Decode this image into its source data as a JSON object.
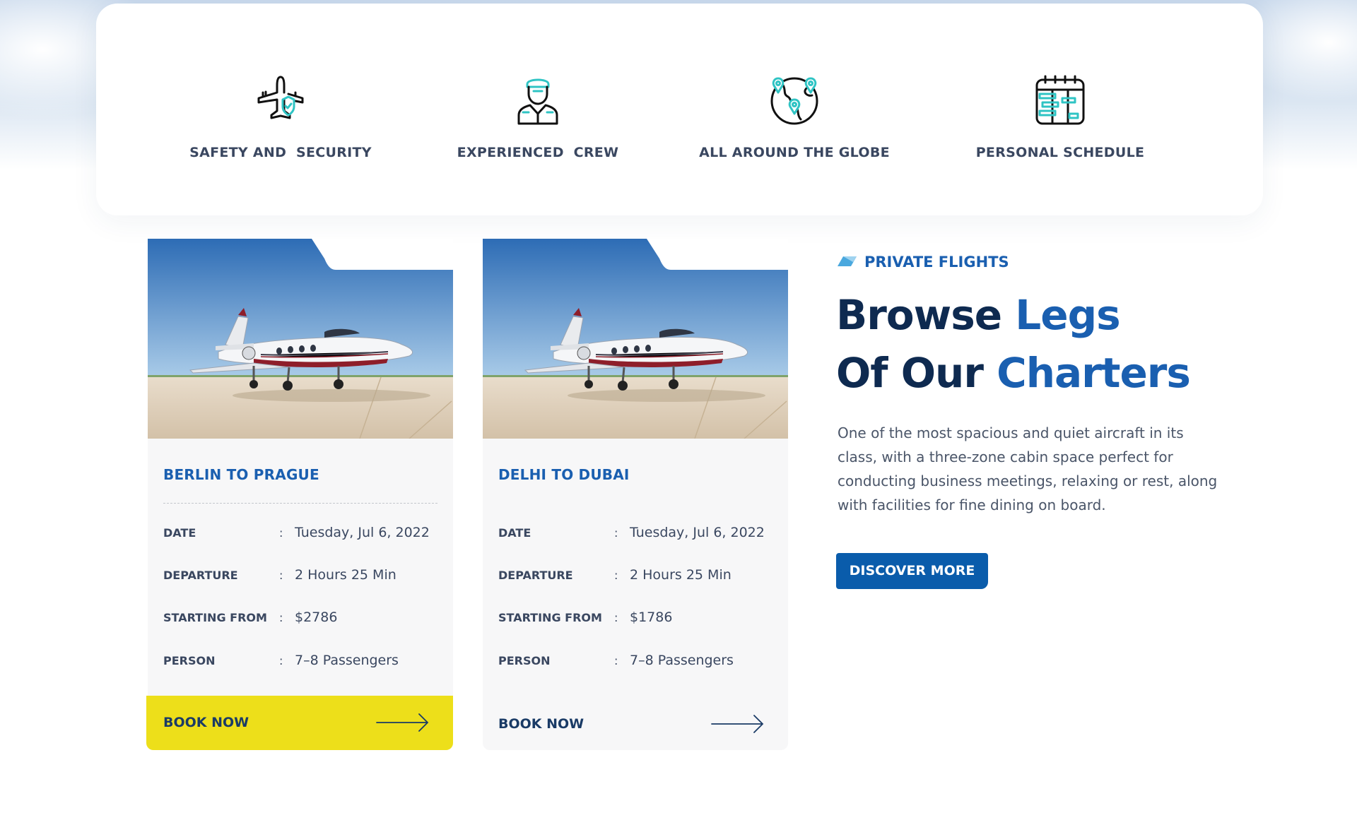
{
  "features": [
    {
      "label": "SAFETY AND  SECURITY",
      "icon": "airplane-shield-icon"
    },
    {
      "label": "EXPERIENCED  CREW",
      "icon": "pilot-icon"
    },
    {
      "label": "ALL AROUND THE GLOBE",
      "icon": "globe-pins-icon"
    },
    {
      "label": "PERSONAL SCHEDULE",
      "icon": "calendar-schedule-icon"
    }
  ],
  "cards": [
    {
      "route": "BERLIN TO PRAGUE",
      "rows": [
        {
          "key": "DATE",
          "sep": ":",
          "value": "Tuesday, Jul 6, 2022"
        },
        {
          "key": "DEPARTURE",
          "sep": ":",
          "value": "2 Hours 25 Min"
        },
        {
          "key": "STARTING FROM",
          "sep": ":",
          "value": "$2786"
        },
        {
          "key": "PERSON",
          "sep": ":",
          "value": "7–8 Passengers"
        }
      ],
      "book_label": "BOOK NOW",
      "book_active": true
    },
    {
      "route": "DELHI TO DUBAI",
      "rows": [
        {
          "key": "DATE",
          "sep": ":",
          "value": "Tuesday, Jul 6, 2022"
        },
        {
          "key": "DEPARTURE",
          "sep": ":",
          "value": "2 Hours 25 Min"
        },
        {
          "key": "STARTING FROM",
          "sep": ":",
          "value": "$1786"
        },
        {
          "key": "PERSON",
          "sep": ":",
          "value": "7–8 Passengers"
        }
      ],
      "book_label": "BOOK NOW",
      "book_active": false
    }
  ],
  "section": {
    "tagline": "PRIVATE FLIGHTS",
    "heading_line1_a": "Browse ",
    "heading_line1_b": "Legs",
    "heading_line2_a": "Of Our ",
    "heading_line2_b": "Charters",
    "description": "One of the most spacious and quiet aircraft in its class, with a three-zone cabin space perfect for conducting business meetings, relaxing or rest, along with facilities for fine dining on board.",
    "button_label": "DISCOVER MORE"
  },
  "colors": {
    "accent_blue": "#1a5fb0",
    "dark_navy": "#0e2a50",
    "book_yellow": "#eddf1a",
    "icon_teal": "#2fc4c4"
  }
}
